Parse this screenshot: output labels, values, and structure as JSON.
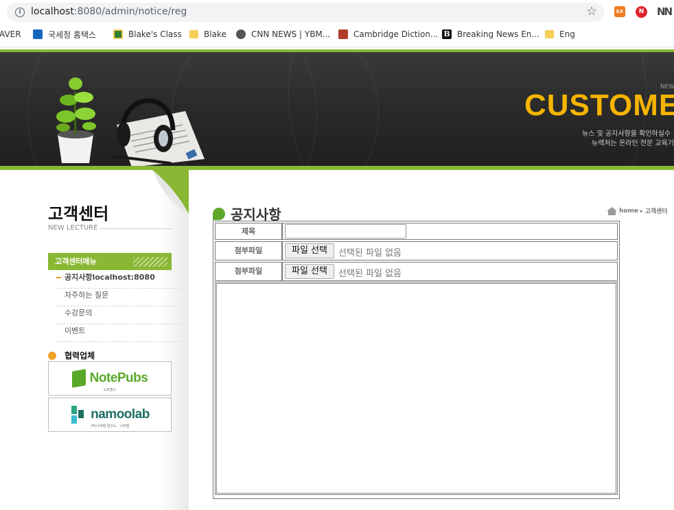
{
  "browser": {
    "url_host": "localhost",
    "url_rest": ":8080/admin/notice/reg",
    "bookmarks": [
      {
        "label": "AVER",
        "icon": "naver-icon"
      },
      {
        "label": "국세청 홈택스",
        "icon": "hometax-icon"
      },
      {
        "label": "Blake's Class",
        "icon": "classroom-icon"
      },
      {
        "label": "Blake",
        "icon": "folder-icon"
      },
      {
        "label": "CNN NEWS | YBM...",
        "icon": "globe-icon"
      },
      {
        "label": "Cambridge Diction...",
        "icon": "cambridge-icon"
      },
      {
        "label": "Breaking News En...",
        "icon": "breaking-news-icon"
      },
      {
        "label": "Eng",
        "icon": "folder-icon"
      }
    ],
    "extensions": [
      "EX",
      "N"
    ]
  },
  "banner": {
    "tag": "NEW",
    "title": "CUSTOME",
    "sub1": "뉴스 및 공지사항을 확인하실수",
    "sub2": "뉴렉처는 온라인 전문 교육기"
  },
  "sidebar": {
    "title": "고객센터",
    "subtitle": "NEW LECTURE",
    "menu_title": "고객센터메뉴",
    "items": [
      {
        "label": "공지사항localhost:8080",
        "active": true
      },
      {
        "label": "자주하는 질문",
        "active": false
      },
      {
        "label": "수강문의",
        "active": false
      },
      {
        "label": "이벤트",
        "active": false
      }
    ],
    "partners_title": "협력업체",
    "partners": [
      {
        "name": "NotePubs",
        "sub": "노트펍스"
      },
      {
        "name": "namoolab",
        "sub": "(주)나무랩 연구소 · 나무랩"
      }
    ]
  },
  "main": {
    "title": "공지사항",
    "breadcrumb": [
      "home",
      "고객센터"
    ],
    "form": {
      "title_label": "제목",
      "title_value": "",
      "file_label_1": "첨부파일",
      "file_label_2": "첨부파일",
      "file_button": "파일 선택",
      "file_status": "선택된 파일 없음",
      "content_value": ""
    }
  },
  "colors": {
    "accent_green": "#8ab835",
    "hero_yellow": "#f5b400",
    "partner_dot": "#f0a228"
  }
}
